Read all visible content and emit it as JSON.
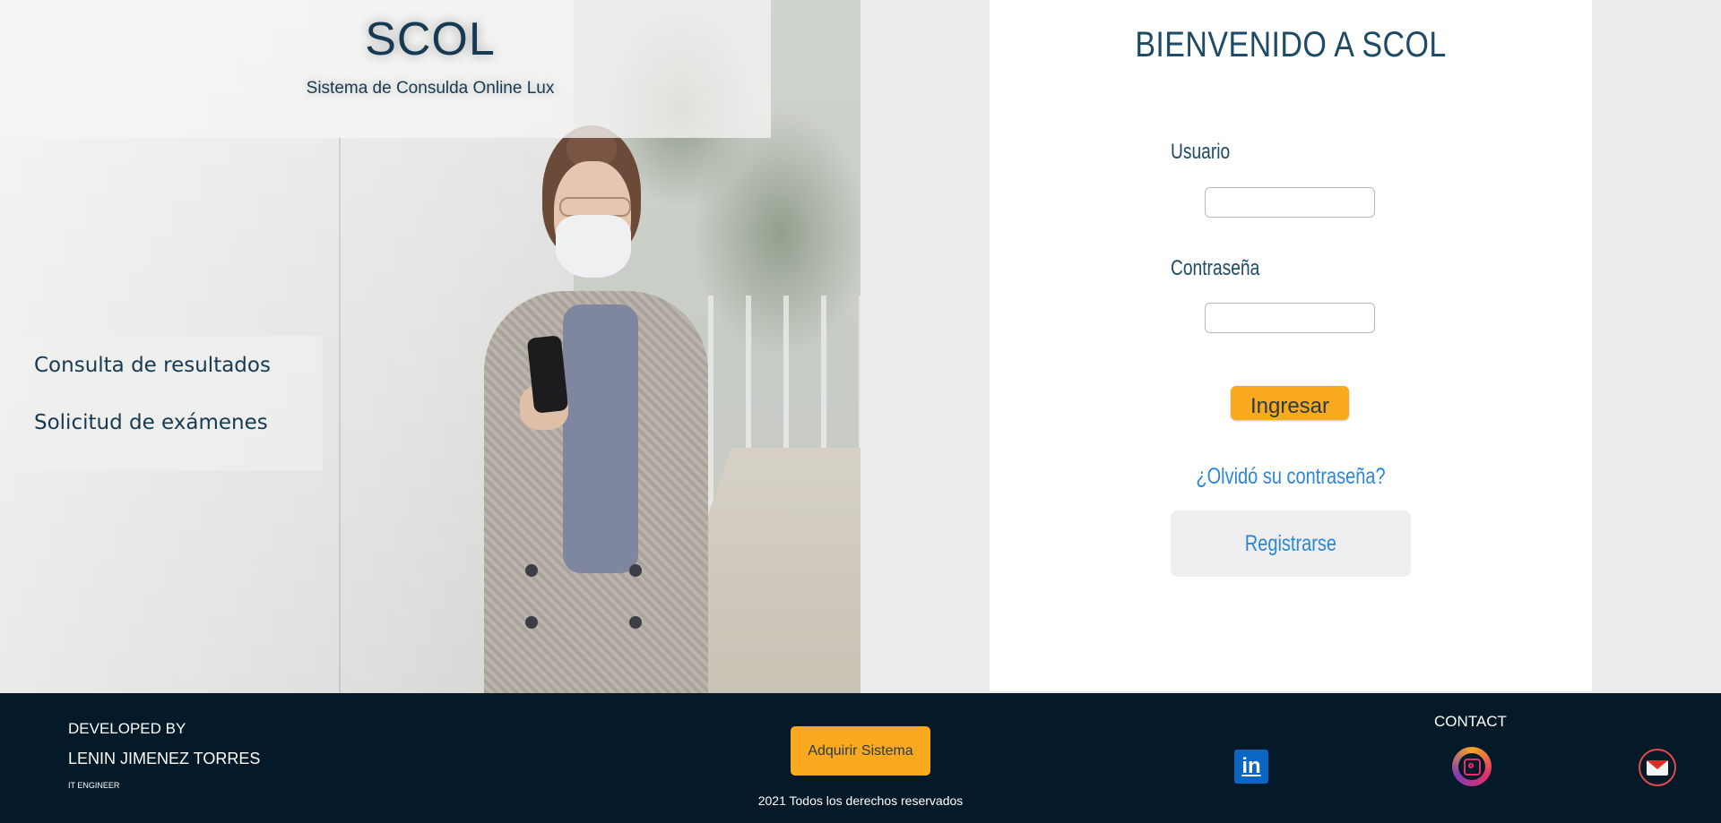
{
  "hero": {
    "title": "SCOL",
    "subtitle": "Sistema de Consulda Online Lux",
    "menu": [
      {
        "label": "Consulta de resultados"
      },
      {
        "label": "Solicitud de exámenes"
      }
    ]
  },
  "login": {
    "welcome": "BIENVENIDO A SCOL",
    "user_label": "Usuario",
    "user_value": "",
    "password_label": "Contraseña",
    "password_value": "",
    "submit_label": "Ingresar",
    "forgot_label": "¿Olvidó su contraseña?",
    "register_label": "Registrarse"
  },
  "footer": {
    "developed_by": "DEVELOPED BY",
    "developer_name": "LENIN JIMENEZ TORRES",
    "developer_role": "IT ENGINEER",
    "buy_button": "Adquirir Sistema",
    "copyright": "2021 Todos los derechos reservados",
    "contact_title": "CONTACT",
    "linkedin_glyph": "in",
    "social_icons": [
      "linkedin-icon",
      "instagram-icon",
      "gmail-icon"
    ]
  },
  "colors": {
    "accent": "#f9a91e",
    "primary_text": "#1d4a66",
    "link": "#2a86d6",
    "footer_bg": "#041a28"
  }
}
